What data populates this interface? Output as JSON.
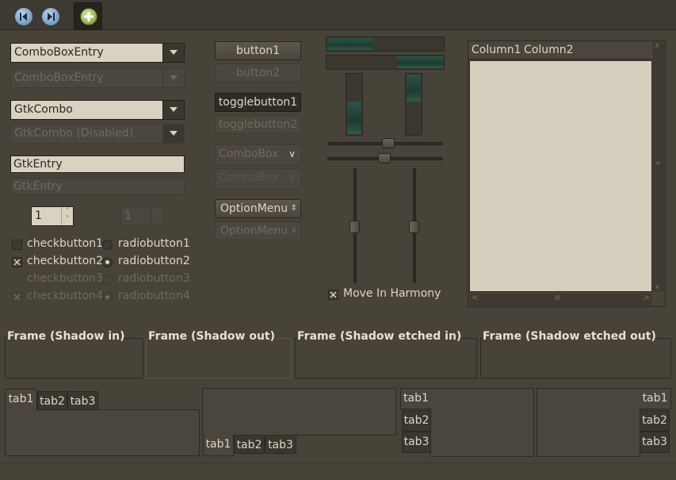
{
  "colors": {
    "window_bg": "#474339",
    "entry_bg": "#d8d2c0",
    "progress": "#2b5446",
    "treeview_bg": "#d6cfbd"
  },
  "toolbar": {
    "icons": [
      "media-previous-icon",
      "media-next-icon",
      "add-icon"
    ]
  },
  "combo_entry": {
    "label": "ComboBoxEntry",
    "label_disabled": "ComboBoxEntry"
  },
  "gtk_combo": {
    "label": "GtkCombo",
    "label_disabled": "GtkCombo (Disabled)"
  },
  "gtk_entry": {
    "value": "GtkEntry",
    "value_disabled": "GtkEntry"
  },
  "spin": {
    "value": "1",
    "value_disabled": "1"
  },
  "checks": [
    {
      "label": "checkbutton1",
      "checked": false
    },
    {
      "label": "checkbutton2",
      "checked": true
    },
    {
      "label": "checkbutton3",
      "checked": false
    },
    {
      "label": "checkbutton4",
      "checked": true
    }
  ],
  "radios": [
    {
      "label": "radiobutton1",
      "selected": false
    },
    {
      "label": "radiobutton2",
      "selected": true
    },
    {
      "label": "radiobutton3",
      "selected": false
    },
    {
      "label": "radiobutton4",
      "selected": true
    }
  ],
  "buttons": {
    "button1": "button1",
    "button2": "button2",
    "toggle1": "togglebutton1",
    "toggle2": "togglebutton2"
  },
  "combobox": {
    "label": "ComboBox",
    "label_disabled": "ComboBox"
  },
  "option_menu": {
    "label": "OptionMenu",
    "label_disabled": "OptionMenu"
  },
  "progress": {
    "h1": 0.4,
    "h2": 0.4,
    "v1": 0.55,
    "v2": 0.55
  },
  "scales": {
    "h1": 0.5,
    "h2": 0.5,
    "v1": 0.5,
    "v2": 0.5
  },
  "harmony": {
    "label": "Move In Harmony",
    "checked": true
  },
  "tree": {
    "columns": [
      "Column1",
      "Column2"
    ],
    "scroll_grip": "III"
  },
  "frames": [
    "Frame (Shadow in)",
    "Frame (Shadow out)",
    "Frame (Shadow etched in)",
    "Frame (Shadow etched out)"
  ],
  "notebooks": {
    "tabs": [
      "tab1",
      "tab2",
      "tab3"
    ]
  }
}
